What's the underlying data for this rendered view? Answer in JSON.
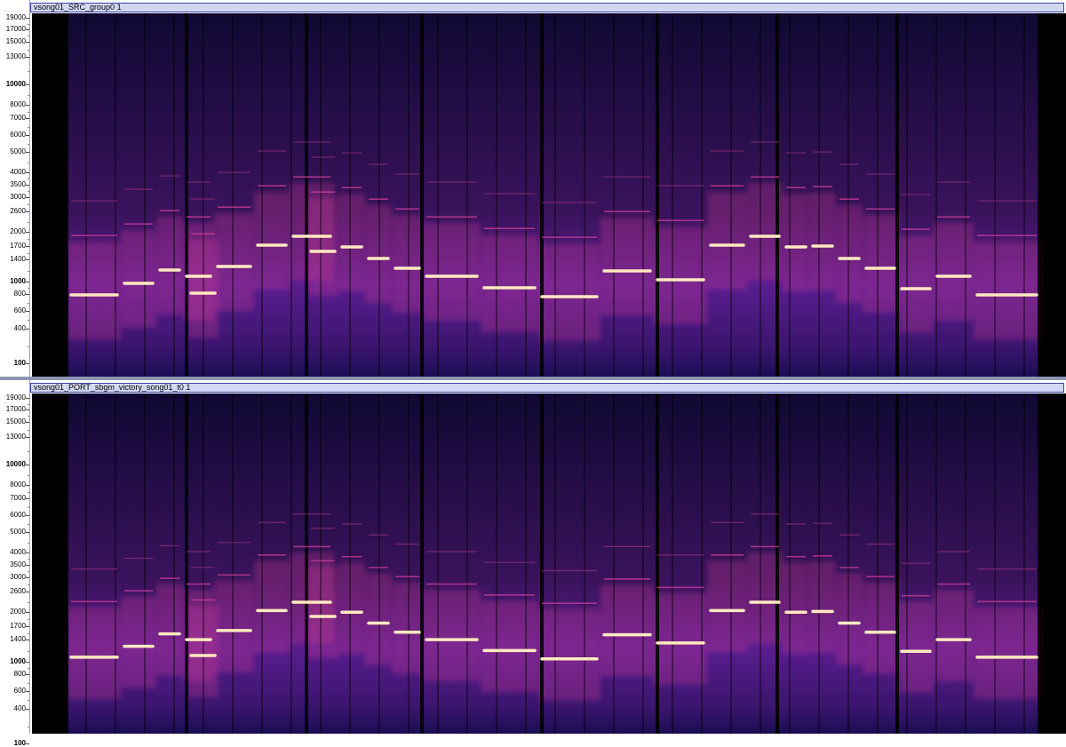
{
  "tracks": [
    {
      "name": "vsong01_SRC_group0 1"
    },
    {
      "name": "vsong01_PORT_sbgm_victory_song01_t0 1"
    }
  ],
  "ruler": {
    "labels": [
      "19000",
      "17000",
      "15000",
      "13000",
      "10000",
      "8000",
      "7000",
      "6000",
      "5000",
      "4000",
      "3500",
      "3000",
      "2600",
      "2000",
      "1700",
      "1400",
      "1000",
      "800",
      "600",
      "400",
      "100"
    ],
    "bold_labels": [
      "10000",
      "1000",
      "100"
    ]
  },
  "colors": {
    "background": "#000000",
    "low": "#1c0f5c",
    "mid": "#6a22a8",
    "high": "#d8409a",
    "peak": "#ffe9c0",
    "track_header": "#d3d8f2",
    "track_header_border": "#3a46a6"
  }
}
